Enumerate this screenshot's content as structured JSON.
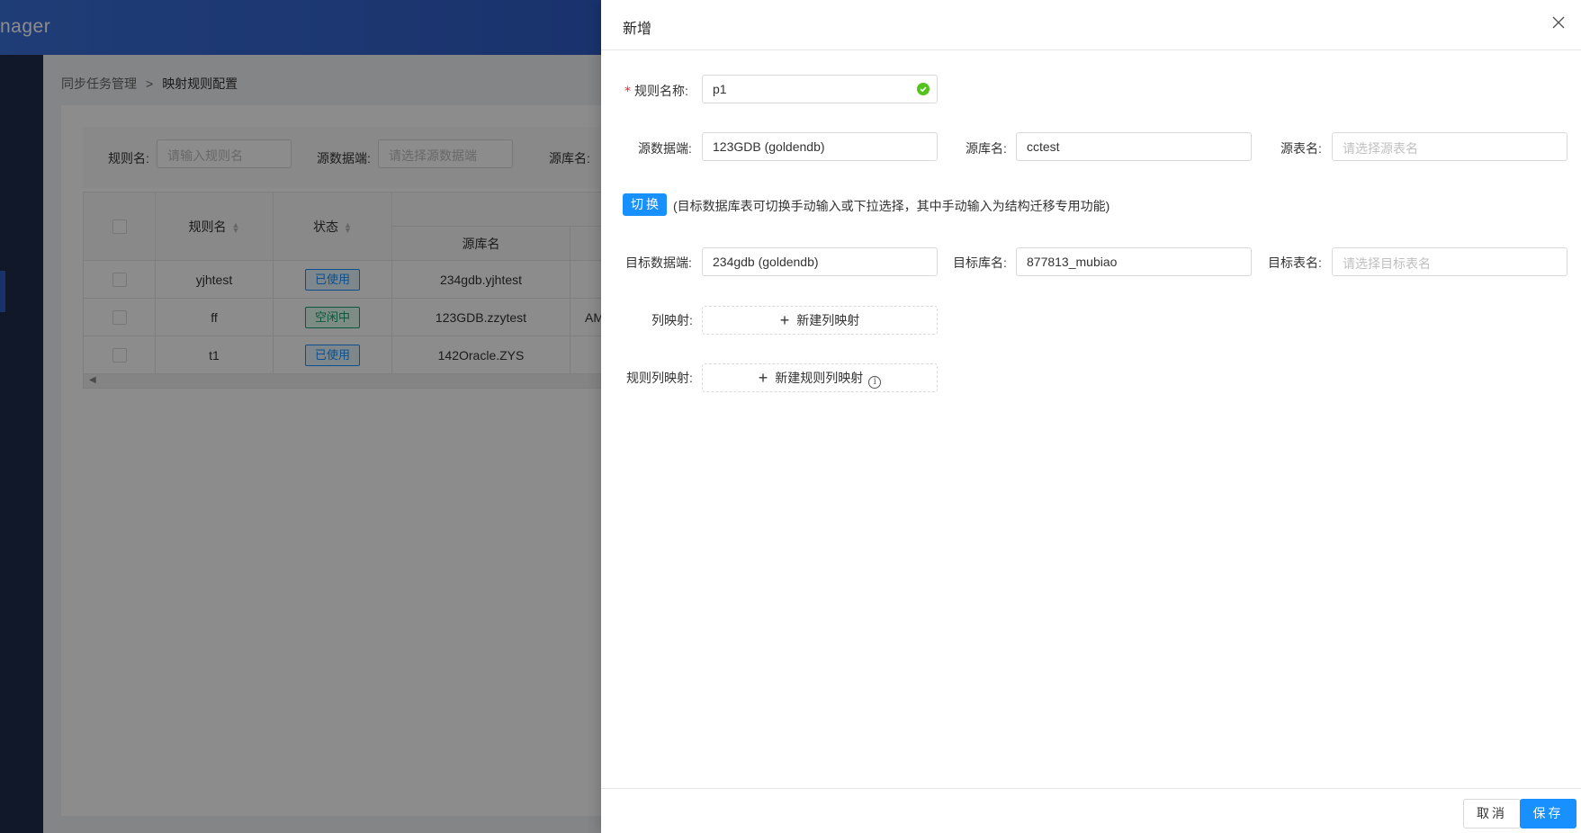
{
  "app": {
    "logo_text": "nager"
  },
  "breadcrumb": {
    "parent": "同步任务管理",
    "separator": ">",
    "current": "映射规则配置"
  },
  "filters": {
    "rule_name_label": "规则名:",
    "rule_name_placeholder": "请输入规则名",
    "source_label": "源数据端:",
    "source_placeholder": "请选择源数据端",
    "db_label": "源库名:"
  },
  "table": {
    "headers": {
      "rule_name": "规则名",
      "status": "状态",
      "source_db": "源库名"
    },
    "rows": [
      {
        "name": "yjhtest",
        "status": "已使用",
        "status_color": "#1890ff",
        "source_db": "234gdb.yjhtest",
        "extra": ""
      },
      {
        "name": "ff",
        "status": "空闲中",
        "status_color": "#13a073",
        "source_db": "123GDB.zzytest",
        "extra": "AM"
      },
      {
        "name": "t1",
        "status": "已使用",
        "status_color": "#1890ff",
        "source_db": "142Oracle.ZYS",
        "extra": ""
      }
    ]
  },
  "drawer": {
    "title": "新增",
    "rule_name": {
      "required_mark": "*",
      "label": "规则名称:",
      "value": "p1"
    },
    "source_endpoint": {
      "label": "源数据端:",
      "value": "123GDB (goldendb)"
    },
    "source_db": {
      "label": "源库名:",
      "value": "cctest"
    },
    "source_table": {
      "label": "源表名:",
      "placeholder": "请选择源表名"
    },
    "switch_button": "切换",
    "switch_hint": "(目标数据库表可切换手动输入或下拉选择，其中手动输入为结构迁移专用功能)",
    "target_endpoint": {
      "label": "目标数据端:",
      "value": "234gdb (goldendb)"
    },
    "target_db": {
      "label": "目标库名:",
      "value": "877813_mubiao"
    },
    "target_table": {
      "label": "目标表名:",
      "placeholder": "请选择目标表名"
    },
    "column_mapping": {
      "label": "列映射:",
      "button": "新建列映射"
    },
    "rule_column_mapping": {
      "label": "规则列映射:",
      "button": "新建规则列映射"
    },
    "footer": {
      "cancel": "取消",
      "save": "保存"
    }
  },
  "colors": {
    "primary": "#1890ff",
    "success": "#52c41a",
    "header_bg": "#2f5cc6",
    "sidebar_bg": "#1f2d4d"
  }
}
